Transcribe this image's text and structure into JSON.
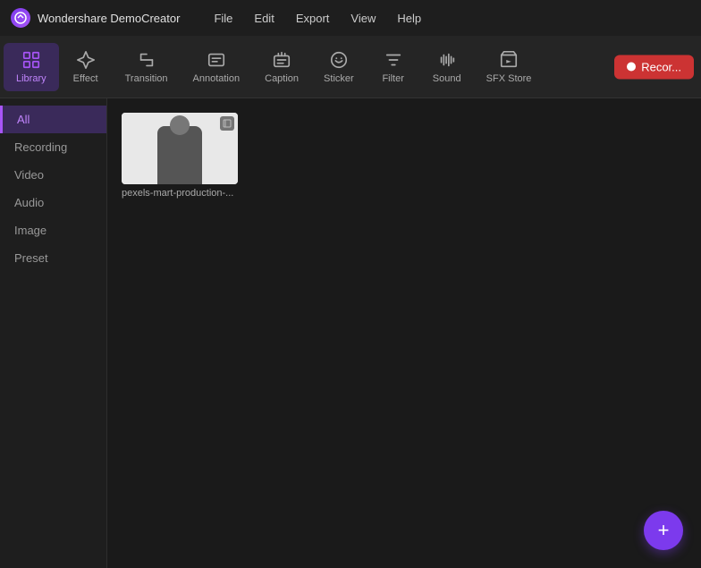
{
  "app": {
    "logo_letter": "C",
    "name": "Wondershare DemoCreator"
  },
  "menu": {
    "items": [
      "File",
      "Edit",
      "Export",
      "View",
      "Help"
    ]
  },
  "toolbar": {
    "items": [
      {
        "id": "library",
        "label": "Library",
        "active": true
      },
      {
        "id": "effect",
        "label": "Effect",
        "active": false
      },
      {
        "id": "transition",
        "label": "Transition",
        "active": false
      },
      {
        "id": "annotation",
        "label": "Annotation",
        "active": false
      },
      {
        "id": "caption",
        "label": "Caption",
        "active": false
      },
      {
        "id": "sticker",
        "label": "Sticker",
        "active": false
      },
      {
        "id": "filter",
        "label": "Filter",
        "active": false
      },
      {
        "id": "sound",
        "label": "Sound",
        "active": false
      },
      {
        "id": "sfxstore",
        "label": "SFX Store",
        "active": false
      }
    ],
    "record_label": "Recor..."
  },
  "sidebar": {
    "items": [
      {
        "id": "all",
        "label": "All",
        "active": true
      },
      {
        "id": "recording",
        "label": "Recording",
        "active": false
      },
      {
        "id": "video",
        "label": "Video",
        "active": false
      },
      {
        "id": "audio",
        "label": "Audio",
        "active": false
      },
      {
        "id": "image",
        "label": "Image",
        "active": false
      },
      {
        "id": "preset",
        "label": "Preset",
        "active": false
      }
    ]
  },
  "content": {
    "media_items": [
      {
        "id": "media1",
        "name": "pexels-mart-production-...",
        "has_badge": true
      }
    ]
  },
  "fab": {
    "icon": "+"
  }
}
